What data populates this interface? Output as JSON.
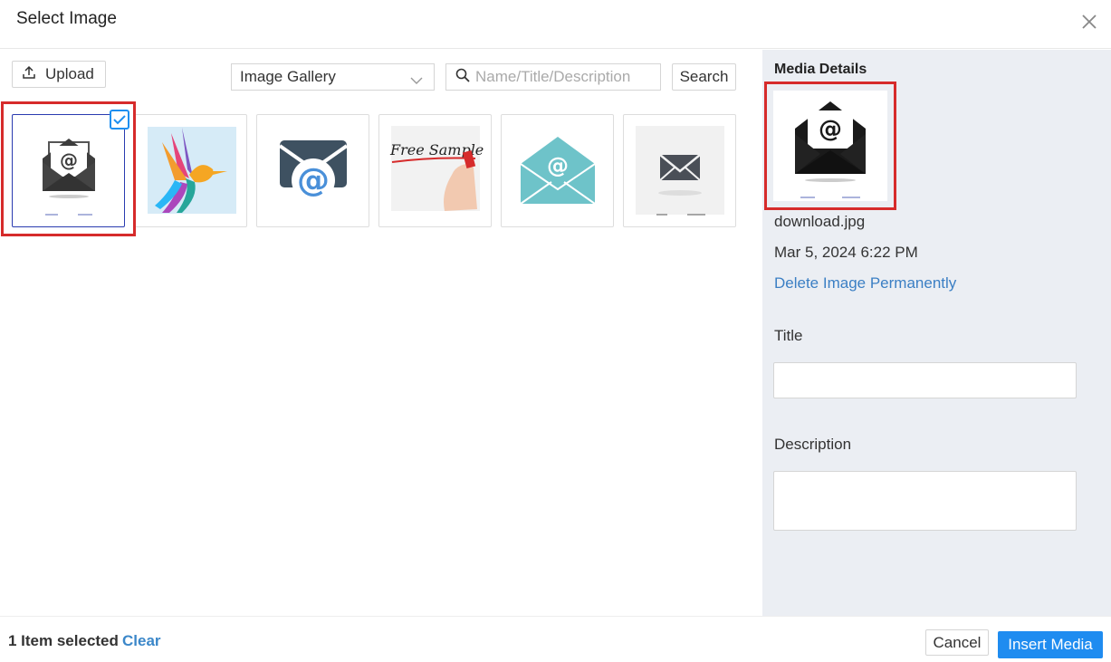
{
  "dialog": {
    "title": "Select Image"
  },
  "toolbar": {
    "upload_label": "Upload",
    "gallery_selected": "Image Gallery",
    "search_placeholder": "Name/Title/Description",
    "search_label": "Search"
  },
  "gallery": {
    "items": [
      {
        "icon": "email-open-at-icon",
        "selected": true
      },
      {
        "icon": "hummingbird-icon",
        "selected": false
      },
      {
        "icon": "email-at-icon",
        "selected": false
      },
      {
        "text": "Free Sample",
        "icon": "free-sample-image",
        "selected": false
      },
      {
        "icon": "email-teal-icon",
        "selected": false
      },
      {
        "icon": "envelope-icon",
        "selected": false
      }
    ]
  },
  "media_details": {
    "heading": "Media Details",
    "filename": "download.jpg",
    "date": "Mar 5, 2024 6:22 PM",
    "delete_label": "Delete Image Permanently",
    "title_label": "Title",
    "title_value": "",
    "description_label": "Description",
    "description_value": ""
  },
  "footer": {
    "selected_count": "1 Item selected",
    "clear_label": "Clear",
    "cancel_label": "Cancel",
    "insert_label": "Insert Media"
  },
  "colors": {
    "accent": "#1f8cf0",
    "link": "#3b7fc4",
    "highlight": "#d62b2b",
    "panel": "#ebeef3"
  }
}
